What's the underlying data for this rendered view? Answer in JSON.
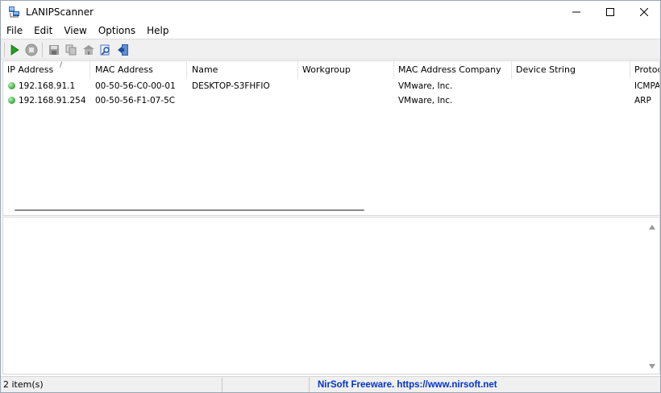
{
  "window": {
    "title": "LANIPScanner",
    "icon": "network-scanner-icon",
    "controls": {
      "minimize": "minimize-icon",
      "maximize": "maximize-icon",
      "close": "close-icon"
    }
  },
  "menu": {
    "items": [
      "File",
      "Edit",
      "View",
      "Options",
      "Help"
    ]
  },
  "toolbar": {
    "buttons": [
      "play-icon",
      "stop-icon",
      "save-icon",
      "copy-icon",
      "html-report-icon",
      "find-icon",
      "exit-icon"
    ]
  },
  "list": {
    "sort_indicator": "/",
    "columns": [
      "IP Address",
      "MAC Address",
      "Name",
      "Workgroup",
      "MAC Address Company",
      "Device String",
      "Protoc"
    ],
    "rows": [
      {
        "ip": "192.168.91.1",
        "mac": "00-50-56-C0-00-01",
        "name": "DESKTOP-S3FHFIO",
        "workgroup": "",
        "company": "VMware, Inc.",
        "device_string": "",
        "protocol": "ICMPA"
      },
      {
        "ip": "192.168.91.254",
        "mac": "00-50-56-F1-07-5C",
        "name": "",
        "workgroup": "",
        "company": "VMware, Inc.",
        "device_string": "",
        "protocol": "ARP"
      }
    ]
  },
  "statusbar": {
    "count": "2 item(s)",
    "middle": "",
    "link": "NirSoft Freeware. https://www.nirsoft.net"
  },
  "colors": {
    "link": "#0033cc",
    "status_dot": "#3aa53a",
    "toolbar_bg": "#f0f0f0"
  }
}
